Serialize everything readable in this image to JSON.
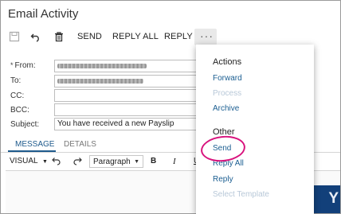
{
  "window": {
    "title": "Email Activity"
  },
  "toolbar": {
    "save_icon": "save-icon",
    "undo_icon": "undo-icon",
    "delete_icon": "trash-icon",
    "send_label": "SEND",
    "reply_all_label": "REPLY ALL",
    "reply_label": "REPLY",
    "more_label": "···"
  },
  "form": {
    "from_required_mark": "*",
    "from_label": "From:",
    "to_label": "To:",
    "cc_label": "CC:",
    "bcc_label": "BCC:",
    "subject_label": "Subject:",
    "subject_value": "You have received a new Payslip"
  },
  "tabs": [
    {
      "label": "MESSAGE",
      "active": true
    },
    {
      "label": "DETAILS",
      "active": false
    }
  ],
  "editor": {
    "visual_label": "VISUAL",
    "paragraph_value": "Paragraph",
    "bold_label": "B",
    "italic_label": "I",
    "underline_label": "U"
  },
  "banner_text": "Y",
  "menu": {
    "actions_heading": "Actions",
    "actions": [
      {
        "label": "Forward",
        "enabled": true
      },
      {
        "label": "Process",
        "enabled": false
      },
      {
        "label": "Archive",
        "enabled": true
      }
    ],
    "other_heading": "Other",
    "other": [
      {
        "label": "Send",
        "enabled": true
      },
      {
        "label": "Reply All",
        "enabled": true
      },
      {
        "label": "Reply",
        "enabled": true
      },
      {
        "label": "Select Template",
        "enabled": false
      }
    ]
  },
  "colors": {
    "link": "#1b5e91",
    "accent": "#1e5a8c",
    "highlight": "#d8137d",
    "banner": "#12407a"
  }
}
